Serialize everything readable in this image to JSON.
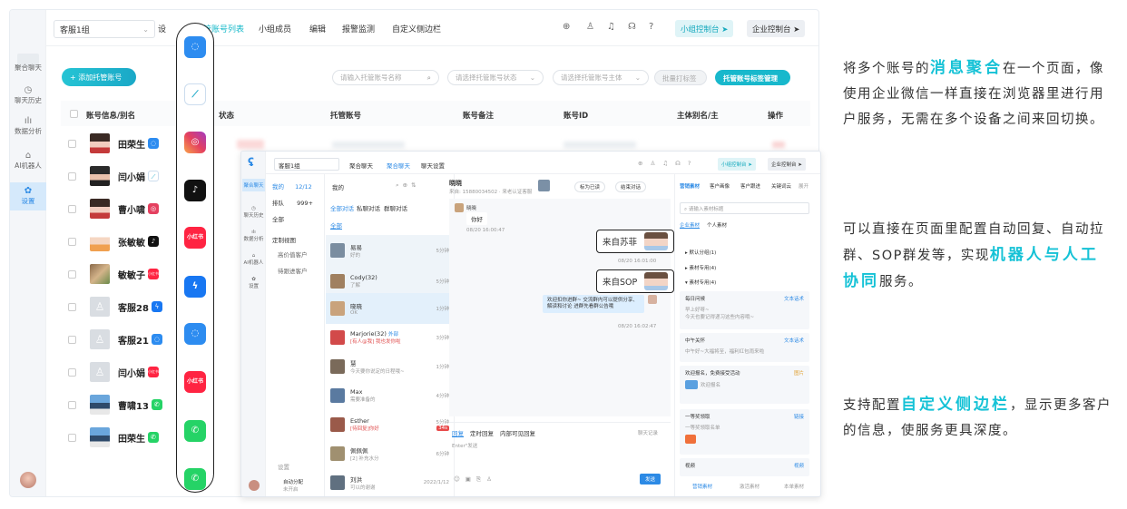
{
  "main": {
    "group_select": "客服1组",
    "settings_partial": "设",
    "tabs": [
      "托管账号列表",
      "小组成员",
      "编辑",
      "报警监测",
      "自定义侧边栏"
    ],
    "team_console": "小组控制台",
    "ent_console": "企业控制台",
    "add_button": "+ 添加托管账号",
    "search_name_placeholder": "请输入托管账号名称",
    "status_placeholder": "请选择托管账号状态",
    "owner_placeholder": "请选择托管账号主体",
    "batch_tag": "批量打标签",
    "tag_manage": "托管账号标签管理",
    "columns": [
      "账号信息/别名",
      "状态",
      "托管账号",
      "账号备注",
      "账号ID",
      "主体别名/主",
      "操作"
    ],
    "rows": [
      {
        "name": "田荣生",
        "channel": "chat"
      },
      {
        "name": "闫小娟",
        "channel": "feather"
      },
      {
        "name": "曹小啸",
        "channel": "instagram"
      },
      {
        "name": "张敏敏",
        "channel": "tiktok"
      },
      {
        "name": "敏敏子",
        "channel": "xhs"
      },
      {
        "name": "客服28",
        "channel": "messenger"
      },
      {
        "name": "客服21",
        "channel": "chat"
      },
      {
        "name": "闫小娟",
        "channel": "xhs"
      },
      {
        "name": "曹啸13",
        "channel": "whatsapp"
      },
      {
        "name": "田荣生",
        "channel": "whatsapp"
      }
    ]
  },
  "sidebar": {
    "items": [
      {
        "label": "聚合聊天",
        "icon": "chat-icon"
      },
      {
        "label": "聊天历史",
        "icon": "clock-icon"
      },
      {
        "label": "数据分析",
        "icon": "bar-chart-icon"
      },
      {
        "label": "AI机器人",
        "icon": "robot-icon"
      },
      {
        "label": "设置",
        "icon": "gear-icon"
      }
    ]
  },
  "bubble_channels": [
    {
      "icon": "chat-icon",
      "color": "#2d8cf0",
      "text": "◌"
    },
    {
      "icon": "feather-icon",
      "color": "#ffffff",
      "text": "⟋"
    },
    {
      "icon": "instagram-icon",
      "color": "#e4405f",
      "text": "◎"
    },
    {
      "icon": "tiktok-icon",
      "color": "#111111",
      "text": "♪"
    },
    {
      "icon": "xiaohongshu-icon",
      "color": "#ff2442",
      "text": "小红书"
    },
    {
      "icon": "messenger-icon",
      "color": "#1877f2",
      "text": "ϟ"
    },
    {
      "icon": "chat-icon",
      "color": "#2d8cf0",
      "text": "◌"
    },
    {
      "icon": "xiaohongshu-icon",
      "color": "#ff2442",
      "text": "小红书"
    },
    {
      "icon": "whatsapp-icon",
      "color": "#25d366",
      "text": "✆"
    },
    {
      "icon": "whatsapp-icon",
      "color": "#25d366",
      "text": "✆"
    }
  ],
  "inner": {
    "group_select": "客服1组",
    "top_tabs": [
      "聚合聊天",
      "聚合聊天",
      "聊天设置"
    ],
    "team_console": "小组控制台",
    "ent_console": "企业控制台",
    "left_nav": [
      "聚合聊天",
      "聊天历史",
      "数据分析",
      "AI机器人",
      "设置"
    ],
    "filters": [
      {
        "label": "我的",
        "count": "12/12"
      },
      {
        "label": "排队",
        "count": "999+"
      },
      {
        "label": "全部",
        "count": ""
      }
    ],
    "custom_views": "定制视图",
    "views": [
      "高价值客户",
      "待跟进客户"
    ],
    "settings_link": "设置",
    "auto_assign": "自动分配",
    "auto_assign_sub": "未开启",
    "list_title": "我的",
    "list_tabs": [
      "全部对话",
      "私聊对话",
      "群聊对话"
    ],
    "list_all": "全部",
    "conversations": [
      {
        "name": "易易",
        "msg": "好的",
        "time": "5分钟"
      },
      {
        "name": "Cody(32)",
        "msg": "了解",
        "time": "5分钟"
      },
      {
        "name": "晓晓",
        "msg": "OK",
        "time": "1分钟"
      },
      {
        "name": "Marjorie(32)",
        "tag": "外部",
        "msg": "[有人@我] 我也发你啦",
        "time": "3分钟"
      },
      {
        "name": "慧",
        "msg": "今天要你说定的日程哦~",
        "time": "1分钟"
      },
      {
        "name": "Max",
        "msg": "需要准备的",
        "time": "4分钟"
      },
      {
        "name": "Esther",
        "msg": "[待回复]你好",
        "time": "5分钟",
        "badge": "34s"
      },
      {
        "name": "佩佩佩",
        "msg": "[2] 补充水分",
        "time": "6分钟"
      },
      {
        "name": "刘洪",
        "msg": "可以的谢谢",
        "time": "2022/1/12"
      }
    ],
    "chat_name": "晓晓",
    "chat_sub": "来自: 15880034502 · 来老认证客服 ...",
    "mark_read": "标为已读",
    "end_chat": "结束对话",
    "msg_in_name": "晓晓",
    "msg_in_text": "你好",
    "msg_in_time": "08/20 16:00:47",
    "msg_out_time": "08/20 16:01:00",
    "msg_out_text": "欢迎扣你进群~ 交流群内可以提供分享、解读和讨论 进群先看群公告哦",
    "msg_out2_time": "08/20 16:02:47",
    "compose_tabs": [
      "回复",
      "定时回复",
      "内部可见回复"
    ],
    "chat_history": "聊天记录",
    "compose_placeholder": "Enter\"发送",
    "send": "发送",
    "right_tabs": [
      "营销素材",
      "客户画像",
      "客户跟进",
      "关键词云",
      "展开"
    ],
    "search_material": "请输入素材标题",
    "material_tabs": [
      "企业素材",
      "个人素材"
    ],
    "groups": [
      "默认分组(1)",
      "素材专用(4)",
      "素材专用(4)"
    ],
    "cards": [
      {
        "title": "每日问候",
        "tag": "文本话术",
        "line1": "早上好呀~",
        "line2": "今天也要记得递习这些内容哦~"
      },
      {
        "title": "中午关怀",
        "tag": "文本话术",
        "line1": "中午好~大福将至，福利红包雨来啦",
        "line2": ""
      },
      {
        "title": "欢迎报名，免费接受活动",
        "tag": "图片",
        "line1": "欢迎报名",
        "line2": ""
      },
      {
        "title": "一等奖领取",
        "tag": "链接",
        "line1": "一等奖领取名单",
        "line2": ""
      },
      {
        "title": "视频",
        "tag": "视频",
        "line1": "",
        "line2": ""
      }
    ],
    "bottom_tabs": [
      "营销素材",
      "激活素材",
      "本单素材"
    ]
  },
  "callouts": [
    "来自苏菲",
    "来自SOP"
  ],
  "right_text": {
    "p1_a": "将多个账号的",
    "p1_hl": "消息聚合",
    "p1_b": "在一个页面，像使用企业微信一样直接在浏览器里进行用户服务，无需在多个设备之间来回切换。",
    "p2_a": "可以直接在页面里配置自动回复、自动拉群、SOP群发等，实现",
    "p2_hl": "机器人与人工协同",
    "p2_b": "服务。",
    "p3_a": "支持配置",
    "p3_hl": "自定义侧边栏",
    "p3_b": "，显示更多客户的信息，使服务更具深度。"
  },
  "colors": {
    "accent": "#15c2d6",
    "primary": "#2c8ae5"
  }
}
